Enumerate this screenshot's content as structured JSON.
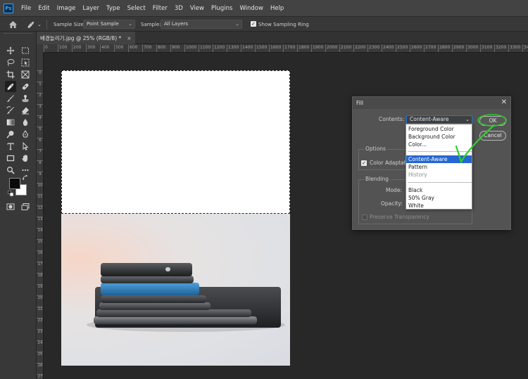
{
  "app": {
    "logo_text": "Ps"
  },
  "menubar": {
    "items": [
      "File",
      "Edit",
      "Image",
      "Layer",
      "Type",
      "Select",
      "Filter",
      "3D",
      "View",
      "Plugins",
      "Window",
      "Help"
    ]
  },
  "options_bar": {
    "sample_size_label": "Sample Size:",
    "sample_size_value": "Point Sample",
    "sample_label": "Sample:",
    "sample_value": "All Layers",
    "show_sampling_ring_label": "Show Sampling Ring",
    "show_sampling_ring_checked": true,
    "dropdown_glyph": "⌄"
  },
  "document_tab": {
    "title": "배경늘리기.jpg @ 25% (RGB/8) *",
    "close": "×"
  },
  "rulers": {
    "top": [
      "0",
      "100",
      "200",
      "300",
      "400",
      "500",
      "600",
      "700",
      "800",
      "900",
      "1000",
      "1100",
      "1200",
      "1300",
      "1400",
      "1500",
      "1600",
      "1700",
      "1800",
      "1900",
      "2000",
      "2100",
      "2200",
      "2300",
      "2400",
      "2500",
      "2600",
      "2700",
      "2800",
      "2900",
      "3000",
      "3100",
      "3200",
      "3300",
      "3400",
      "3500",
      "3600",
      "3700",
      "3800"
    ],
    "left": [
      "0",
      "1",
      "2",
      "3",
      "4",
      "5",
      "6",
      "7",
      "8",
      "9",
      "10",
      "11",
      "12",
      "13",
      "14",
      "15",
      "16",
      "17",
      "18",
      "19",
      "20",
      "21",
      "22",
      "23",
      "24",
      "25",
      "26",
      "27",
      "28"
    ]
  },
  "fill_dialog": {
    "title": "Fill",
    "close": "✕",
    "contents_label": "Contents:",
    "contents_value": "Content-Aware",
    "ok_label": "OK",
    "cancel_label": "Cancel",
    "options_label": "Options",
    "color_adaptation_label": "Color Adaptation",
    "color_adaptation_checked": true,
    "blending_label": "Blending",
    "mode_label": "Mode:",
    "opacity_label": "Opacity:",
    "preserve_transparency_label": "Preserve Transparency",
    "preserve_transparency_checked": false
  },
  "contents_dropdown": {
    "group1": [
      "Foreground Color",
      "Background Color",
      "Color..."
    ],
    "group2": [
      {
        "label": "Content-Aware",
        "selected": true
      },
      {
        "label": "Pattern",
        "selected": false
      },
      {
        "label": "History",
        "disabled": true
      }
    ],
    "group3": [
      "Black",
      "50% Gray",
      "White"
    ]
  },
  "colors": {
    "accent": "#1f76d9",
    "selection": "#2566d0",
    "annotation": "#2ecc2e",
    "foreground_color": "#0a0a0a",
    "background_color": "#ffffff"
  },
  "tools": [
    "move-icon",
    "marquee-icon",
    "lasso-icon",
    "object-select-icon",
    "crop-icon",
    "frame-icon",
    "eyedropper-icon",
    "healing-brush-icon",
    "brush-icon",
    "stamp-icon",
    "history-brush-icon",
    "eraser-icon",
    "gradient-icon",
    "blur-icon",
    "dodge-icon",
    "pen-icon",
    "type-icon",
    "path-select-icon",
    "rectangle-icon",
    "hand-icon",
    "zoom-icon",
    "more-icon",
    "swap-colors-icon",
    "default-colors-icon",
    "quick-mask-icon",
    "screen-mode-icon"
  ]
}
